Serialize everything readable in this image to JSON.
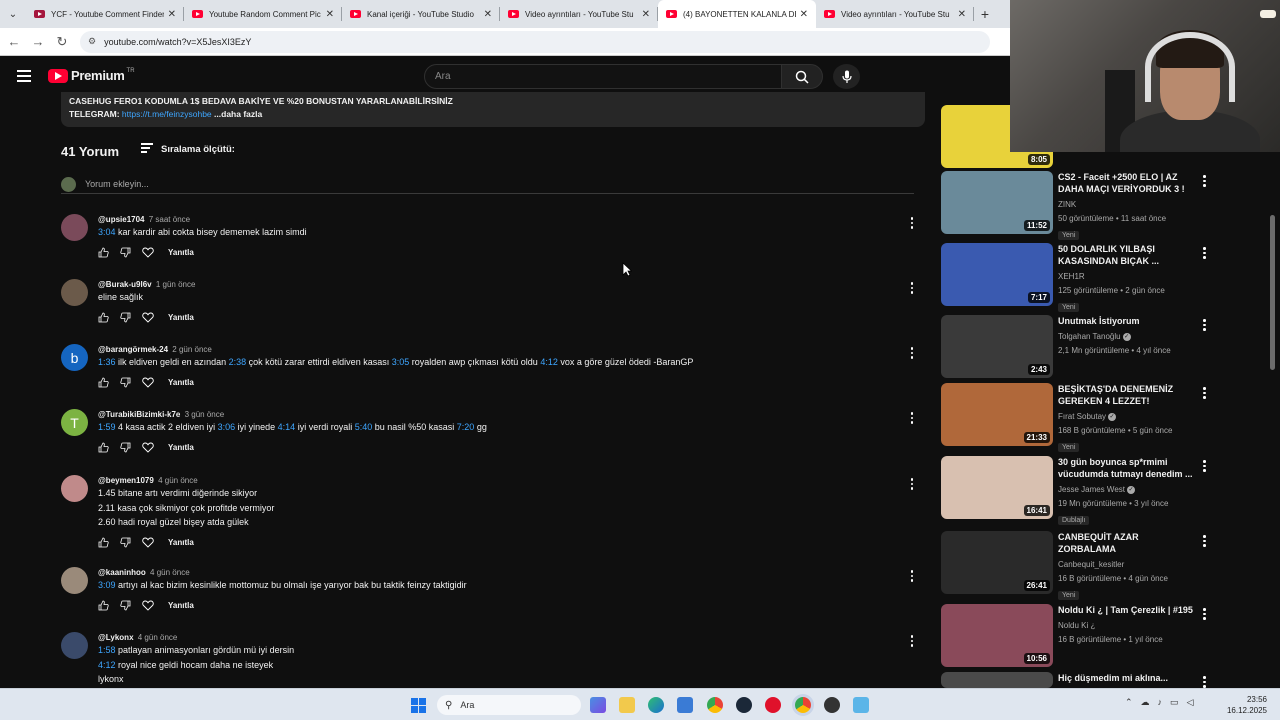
{
  "browser": {
    "tabs": [
      {
        "label": "YCF - Youtube Comment Finder",
        "icon": "ycf-icon",
        "active": false
      },
      {
        "label": "Youtube Random Comment Pic",
        "icon": "youtube-icon",
        "active": false
      },
      {
        "label": "Kanal içeriği - YouTube Studio",
        "icon": "youtube-icon",
        "active": false
      },
      {
        "label": "Video ayrıntıları - YouTube Stu",
        "icon": "youtube-icon",
        "active": false
      },
      {
        "label": "(4) BAYONETTEN KALANLA DE",
        "icon": "youtube-icon",
        "active": true
      },
      {
        "label": "Video ayrıntıları - YouTube Stu",
        "icon": "youtube-icon",
        "active": false
      }
    ],
    "url": "youtube.com/watch?v=X5JesXI3EzY"
  },
  "header": {
    "logo_text": "Premium",
    "country": "TR",
    "search_placeholder": "Ara"
  },
  "description": {
    "line1": "CASEHUG  FERO1 KODUMLA 1$ BEDAVA BAKİYE VE %20 BONUSTAN YARARLANABİLİRSİNİZ",
    "line2_label": "TELEGRAM: ",
    "line2_link": "https://t.me/feinzysohbe",
    "more": "...daha fazla"
  },
  "comments_section": {
    "count": "41 Yorum",
    "sort_label": "Sıralama ölçütü:",
    "add_placeholder": "Yorum ekleyin...",
    "reply_label": "Yanıtla",
    "items": [
      {
        "handle": "@upsie1704",
        "time": "7 saat önce",
        "avatar_color": "#7a4a5a",
        "avatar_letter": "",
        "lines": [
          [
            {
              "ts": "3:04"
            },
            {
              "t": " kar kardir abi cokta bisey dememek lazim simdi"
            }
          ]
        ]
      },
      {
        "handle": "@Burak-u9l6v",
        "time": "1 gün önce",
        "avatar_color": "#6b5a4a",
        "avatar_letter": "",
        "lines": [
          [
            {
              "t": "eline sağlık"
            }
          ]
        ]
      },
      {
        "handle": "@barangörmek-24",
        "time": "2 gün önce",
        "avatar_color": "#1565c0",
        "avatar_letter": "b",
        "lines": [
          [
            {
              "ts": "1:36"
            },
            {
              "t": " ilk eldiven geldi en azından "
            },
            {
              "ts": "2:38"
            },
            {
              "t": " çok kötü zarar ettirdi eldiven kasası "
            },
            {
              "ts": "3:05"
            },
            {
              "t": " royalden awp çıkması kötü oldu "
            },
            {
              "ts": "4:12"
            },
            {
              "t": " vox a göre güzel ödedi -BaranGP"
            }
          ]
        ]
      },
      {
        "handle": "@TurabikiBizimki-k7e",
        "time": "3 gün önce",
        "avatar_color": "#7cb342",
        "avatar_letter": "T",
        "lines": [
          [
            {
              "ts": "1:59"
            },
            {
              "t": " 4 kasa actik 2 eldiven iyi "
            },
            {
              "ts": "3:06"
            },
            {
              "t": " iyi yinede "
            },
            {
              "ts": "4:14"
            },
            {
              "t": " iyi verdi royali "
            },
            {
              "ts": "5:40"
            },
            {
              "t": " bu nasil %50 kasasi "
            },
            {
              "ts": "7:20"
            },
            {
              "t": " gg"
            }
          ]
        ]
      },
      {
        "handle": "@beymen1079",
        "time": "4 gün önce",
        "avatar_color": "#c08a8a",
        "avatar_letter": "",
        "lines": [
          [
            {
              "t": "1.45 bitane artı verdimi diğerinde sikiyor"
            }
          ],
          [
            {
              "t": "2.11 kasa çok sikmiyor çok profitde vermiyor"
            }
          ],
          [
            {
              "t": "2.60 hadi royal güzel bişey atda gülek"
            }
          ]
        ]
      },
      {
        "handle": "@kaaninhoo",
        "time": "4 gün önce",
        "avatar_color": "#9a8a7a",
        "avatar_letter": "",
        "lines": [
          [
            {
              "ts": "3:09"
            },
            {
              "t": " artıyı al kac bizim kesinlikle mottomuz bu olmalı işe yarıyor bak bu taktik feinzy taktigidir"
            }
          ]
        ]
      },
      {
        "handle": "@Lykonx",
        "time": "4 gün önce",
        "avatar_color": "#3a4a6a",
        "avatar_letter": "",
        "lines": [
          [
            {
              "ts": "1:58"
            },
            {
              "t": " patlayan animasyonları gördün mü iyi dersin"
            }
          ],
          [
            {
              "ts": "4:12"
            },
            {
              "t": " royal nice geldi hocam daha ne isteyek"
            }
          ],
          [
            {
              "t": "lykonx"
            }
          ]
        ]
      }
    ]
  },
  "sidebar": {
    "items": [
      {
        "title": "",
        "channel": "",
        "stats": "",
        "badge": "",
        "duration": "8:05",
        "thumb": "#e8d23a",
        "verified": false
      },
      {
        "title": "CS2 - Faceit +2500 ELO | AZ DAHA MAÇI VERİYORDUK 3 ! ...",
        "channel": "ZINK",
        "stats": "50 görüntüleme • 11 saat önce",
        "badge": "Yeni",
        "duration": "11:52",
        "thumb": "#6a8a9a",
        "verified": false
      },
      {
        "title": "50 DOLARLIK YILBAŞI KASASINDAN BIÇAK ...",
        "channel": "XEH1R",
        "stats": "125 görüntüleme • 2 gün önce",
        "badge": "Yeni",
        "duration": "7:17",
        "thumb": "#3a5ab0",
        "verified": false
      },
      {
        "title": "Unutmak İstiyorum",
        "channel": "Tolgahan Tanoğlu",
        "stats": "2,1 Mn görüntüleme • 4 yıl önce",
        "badge": "",
        "duration": "2:43",
        "thumb": "#3a3a3a",
        "verified": true
      },
      {
        "title": "BEŞİKTAŞ'DA DENEMENİZ GEREKEN 4 LEZZET!",
        "channel": "Fırat Sobutay",
        "stats": "168 B görüntüleme • 5 gün önce",
        "badge": "Yeni",
        "duration": "21:33",
        "thumb": "#b0683a",
        "verified": true
      },
      {
        "title": "30 gün boyunca sp*rmimi vücudumda tutmayı denedim ...",
        "channel": "Jesse James West",
        "stats": "19 Mn görüntüleme • 3 yıl önce",
        "badge": "Dublajlı",
        "duration": "16:41",
        "thumb": "#d8c0b0",
        "verified": true
      },
      {
        "title": "CANBEQUİT AZAR ZORBALAMA",
        "channel": "Canbequit_kesitler",
        "stats": "16 B görüntüleme • 4 gün önce",
        "badge": "Yeni",
        "duration": "26:41",
        "thumb": "#2a2a2a",
        "verified": false
      },
      {
        "title": "Noldu Ki ¿ | Tam Çerezlik | #195",
        "channel": "Noldu Ki ¿",
        "stats": "16 B görüntüleme • 1 yıl önce",
        "badge": "",
        "duration": "10:56",
        "thumb": "#8a4a5a",
        "verified": false
      },
      {
        "title": "Hiç düşmedim mi aklına...",
        "channel": "",
        "stats": "",
        "badge": "",
        "duration": "",
        "thumb": "#4a4a4a",
        "verified": false
      }
    ]
  },
  "taskbar": {
    "search_placeholder": "Ara",
    "time": "23:56",
    "date": "16.12.2025"
  }
}
